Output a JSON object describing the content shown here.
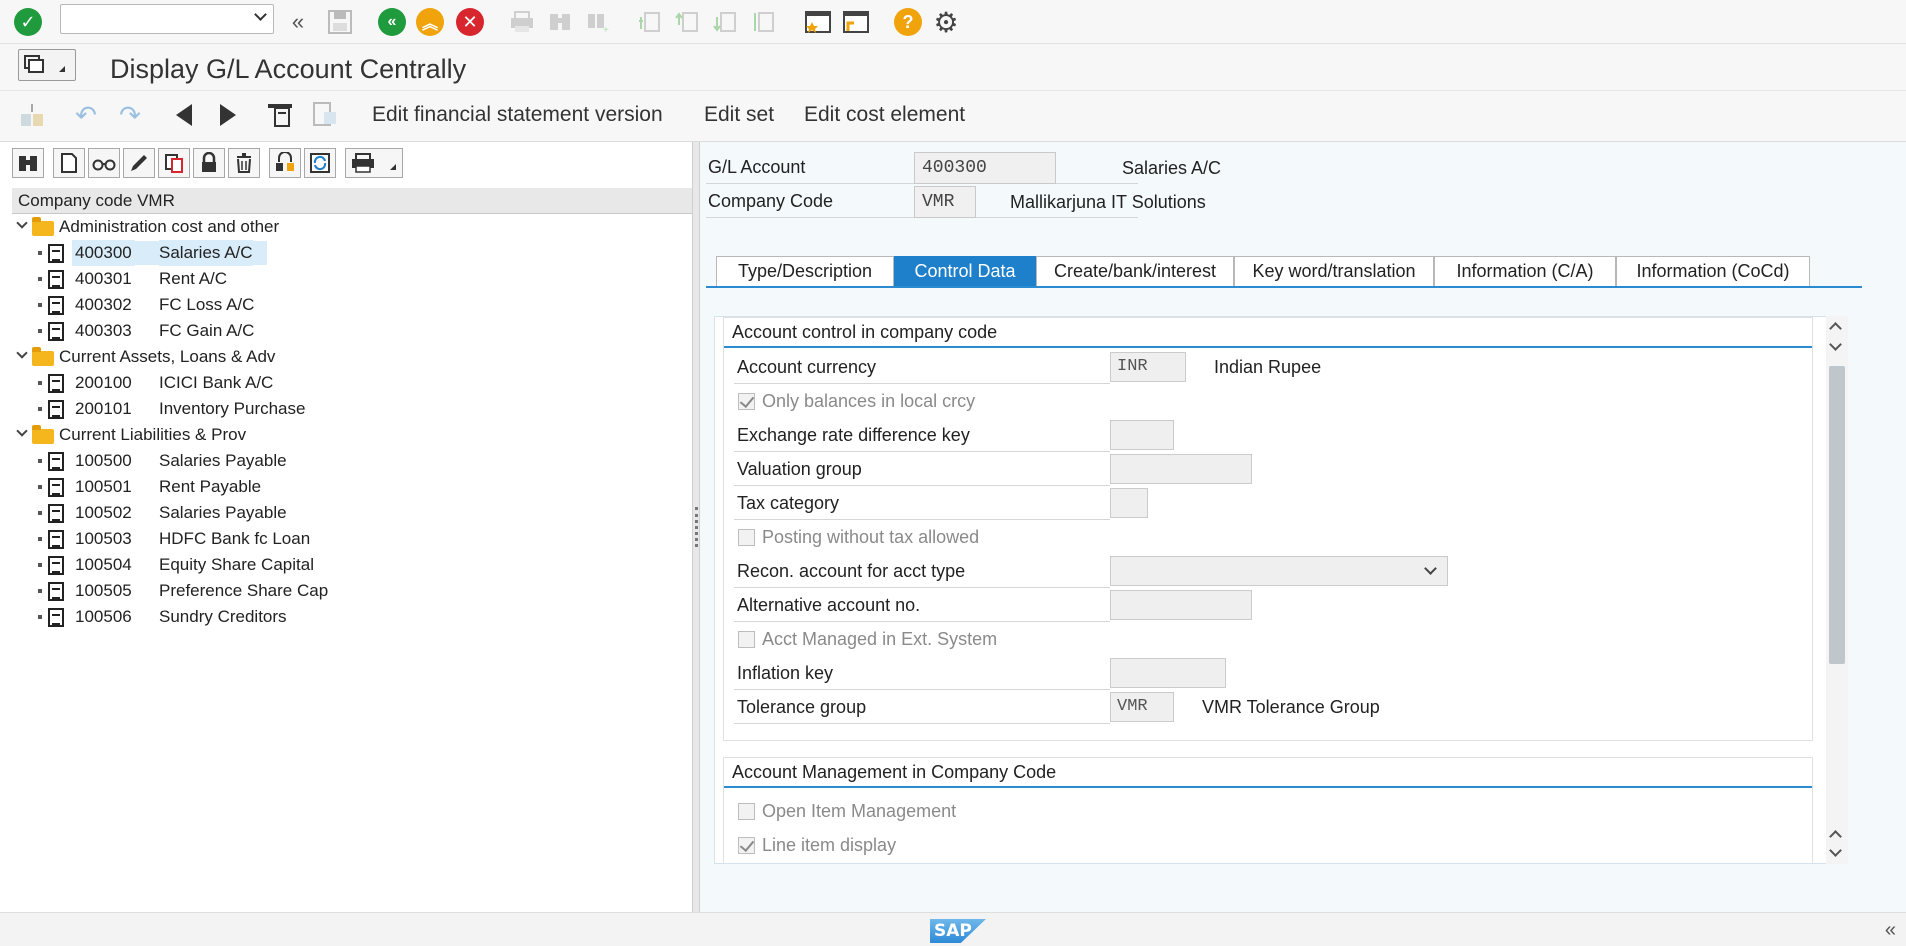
{
  "title": "Display G/L Account Centrally",
  "apptoolbar": {
    "edit_fsv": "Edit financial statement version",
    "edit_set": "Edit set",
    "edit_cost_element": "Edit cost element"
  },
  "tree": {
    "header": "Company code VMR",
    "folders": [
      {
        "label": "Administration cost and other",
        "items": [
          {
            "code": "400300",
            "name": "Salaries A/C",
            "selected": true
          },
          {
            "code": "400301",
            "name": "Rent A/C"
          },
          {
            "code": "400302",
            "name": "FC Loss A/C"
          },
          {
            "code": "400303",
            "name": "FC Gain A/C"
          }
        ]
      },
      {
        "label": "Current Assets, Loans & Adv",
        "items": [
          {
            "code": "200100",
            "name": "ICICI Bank A/C"
          },
          {
            "code": "200101",
            "name": "Inventory Purchase"
          }
        ]
      },
      {
        "label": "Current Liabilities & Prov",
        "items": [
          {
            "code": "100500",
            "name": "Salaries Payable"
          },
          {
            "code": "100501",
            "name": "Rent Payable"
          },
          {
            "code": "100502",
            "name": "Salaries Payable"
          },
          {
            "code": "100503",
            "name": "HDFC Bank fc Loan"
          },
          {
            "code": "100504",
            "name": "Equity Share Capital"
          },
          {
            "code": "100505",
            "name": "Preference Share Cap"
          },
          {
            "code": "100506",
            "name": "Sundry Creditors"
          }
        ]
      }
    ]
  },
  "header": {
    "gl_account_label": "G/L Account",
    "gl_account_value": "400300",
    "gl_account_desc": "Salaries A/C",
    "company_code_label": "Company Code",
    "company_code_value": "VMR",
    "company_code_desc": "Mallikarjuna IT Solutions"
  },
  "tabs": [
    {
      "label": "Type/Description"
    },
    {
      "label": "Control Data",
      "active": true
    },
    {
      "label": "Create/bank/interest"
    },
    {
      "label": "Key word/translation"
    },
    {
      "label": "Information (C/A)"
    },
    {
      "label": "Information (CoCd)"
    }
  ],
  "control": {
    "group_title": "Account control in company code",
    "account_currency_label": "Account currency",
    "account_currency_value": "INR",
    "account_currency_desc": "Indian Rupee",
    "only_balances_label": "Only balances in local crcy",
    "only_balances_checked": true,
    "exchange_rate_label": "Exchange rate difference key",
    "exchange_rate_value": "",
    "valuation_group_label": "Valuation group",
    "valuation_group_value": "",
    "tax_category_label": "Tax category",
    "tax_category_value": "",
    "posting_without_tax_label": "Posting without tax allowed",
    "posting_without_tax_checked": false,
    "recon_account_label": "Recon. account for acct type",
    "recon_account_value": "",
    "alt_account_label": "Alternative account no.",
    "alt_account_value": "",
    "acct_managed_label": "Acct Managed in Ext. System",
    "acct_managed_checked": false,
    "inflation_key_label": "Inflation key",
    "inflation_key_value": "",
    "tolerance_group_label": "Tolerance group",
    "tolerance_group_value": "VMR",
    "tolerance_group_desc": "VMR Tolerance Group"
  },
  "account_mgmt": {
    "group_title": "Account Management in Company Code",
    "open_item_label": "Open Item Management",
    "open_item_checked": false,
    "line_item_label": "Line item display",
    "line_item_checked": true
  },
  "status": {
    "logo": "SAP"
  },
  "colors": {
    "accent": "#1e7fcb",
    "ok_green": "#1f9a3c",
    "cancel_red": "#d8262f",
    "exit_orange": "#f0a30a",
    "help_orange": "#f0a30a",
    "folder": "#f5b51d"
  },
  "icons": [
    "enter-icon",
    "back-icon",
    "exit-icon",
    "cancel-icon",
    "save-icon",
    "print-icon",
    "find-icon",
    "find-next-icon",
    "first-page-icon",
    "prev-page-icon",
    "next-page-icon",
    "last-page-icon",
    "new-session-icon",
    "create-shortcut-icon",
    "help-icon",
    "settings-icon"
  ]
}
